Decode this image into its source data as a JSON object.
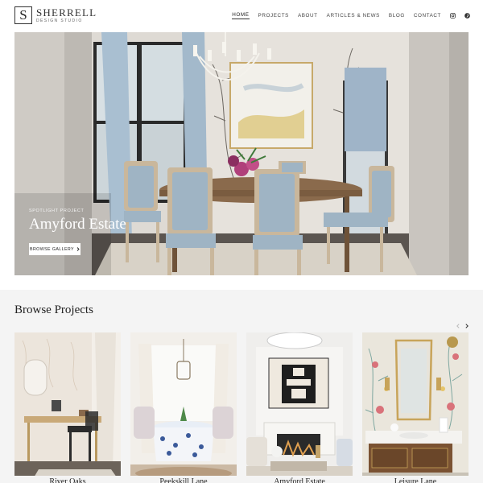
{
  "brand": {
    "mark": "S",
    "name": "SHERRELL",
    "subtitle": "DESIGN STUDIO"
  },
  "nav": {
    "items": [
      {
        "label": "HOME",
        "active": true
      },
      {
        "label": "PROJECTS",
        "active": false
      },
      {
        "label": "ABOUT",
        "active": false
      },
      {
        "label": "ARTICLES & NEWS",
        "active": false
      },
      {
        "label": "BLOG",
        "active": false
      },
      {
        "label": "CONTACT",
        "active": false
      }
    ],
    "icons": [
      "instagram-icon",
      "pinterest-icon"
    ]
  },
  "hero": {
    "label": "SPOTLIGHT PROJECT",
    "title": "Amyford Estate",
    "button": "BROWSE GALLERY"
  },
  "browse": {
    "title": "Browse Projects",
    "projects": [
      {
        "name": "River Oaks"
      },
      {
        "name": "Peekskill Lane"
      },
      {
        "name": "Amyford Estate"
      },
      {
        "name": "Leisure Lane"
      }
    ]
  },
  "colors": {
    "accent": "#222222",
    "section_bg": "#f4f4f4",
    "chair_blue": "#9fb4c4",
    "curtain_blue": "#a9bfd1"
  }
}
